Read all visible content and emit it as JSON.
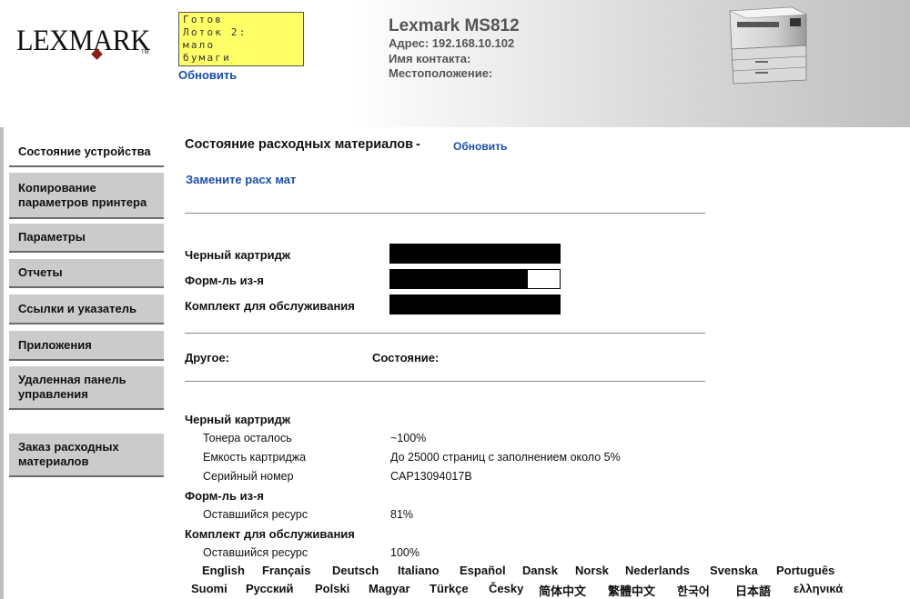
{
  "header": {
    "logo_text": "LEXMARK",
    "trademark": "TM",
    "panel_display_lines": [
      "Готов",
      "Лоток 2:",
      "мало",
      "бумаги"
    ],
    "refresh_label": "Обновить",
    "printer_model": "Lexmark MS812",
    "address": "Адрес: 192.168.10.102",
    "contact": "Имя контакта:",
    "location": "Местоположение:"
  },
  "sidebar": {
    "items": [
      {
        "label": "Состояние устройства",
        "active": true
      },
      {
        "label": "Копирование параметров принтера"
      },
      {
        "label": "Параметры"
      },
      {
        "label": "Отчеты"
      },
      {
        "label": "Ссылки и указатель"
      },
      {
        "label": "Приложения"
      },
      {
        "label": "Удаленная панель управления"
      },
      {
        "label": "Заказ расходных материалов"
      }
    ]
  },
  "main": {
    "title": "Состояние расходных материалов",
    "title_dash": "-",
    "refresh_label": "Обновить",
    "replace_link": "Замените расх мат",
    "supplies": [
      {
        "label": "Черный картридж",
        "level": 1.0
      },
      {
        "label": "Форм-ль из-я",
        "level": 0.81
      },
      {
        "label": "Комплект для обслуживания",
        "level": 1.0
      }
    ],
    "other_header": "Другое:",
    "status_header": "Состояние:",
    "details": [
      {
        "name": "Черный картридж",
        "rows": [
          {
            "label": "Тонера осталось",
            "value": "~100%"
          },
          {
            "label": "Емкость картриджа",
            "value": "До 25000 страниц с заполнением около 5%"
          },
          {
            "label": "Серийный номер",
            "value": "CAP13094017B"
          }
        ]
      },
      {
        "name": "Форм-ль из-я",
        "rows": [
          {
            "label": "Оставшийся ресурс",
            "value": "81%"
          }
        ]
      },
      {
        "name": "Комплект для обслуживания",
        "rows": [
          {
            "label": "Оставшийся ресурс",
            "value": "100%"
          }
        ]
      }
    ]
  },
  "languages": {
    "row1": [
      "English",
      "Français",
      "Deutsch",
      "Italiano",
      "Español",
      "Dansk",
      "Norsk",
      "Nederlands",
      "Svenska",
      "Português"
    ],
    "row2": [
      "Suomi",
      "Русский",
      "Polski",
      "Magyar",
      "Türkçe",
      "Česky",
      "简体中文",
      "繁體中文",
      "한국어",
      "日本語",
      "ελληνικά"
    ]
  }
}
